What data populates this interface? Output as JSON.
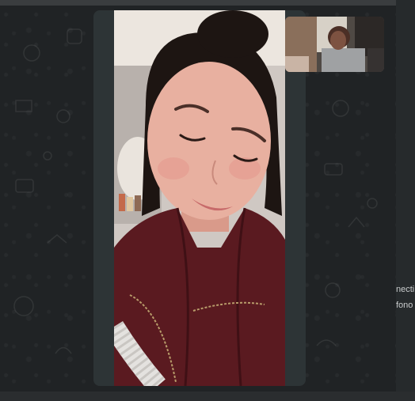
{
  "call": {
    "remote_video": "remote-participant-video",
    "self_video": "self-preview-video"
  },
  "side_panel": {
    "line1": "necti",
    "line2": "fono"
  },
  "colors": {
    "background": "#202325",
    "panel": "#2d3436",
    "jacket": "#5a1a20",
    "skin": "#e8b0a0",
    "hair": "#1d1512",
    "wall": "#d9d2cc"
  }
}
